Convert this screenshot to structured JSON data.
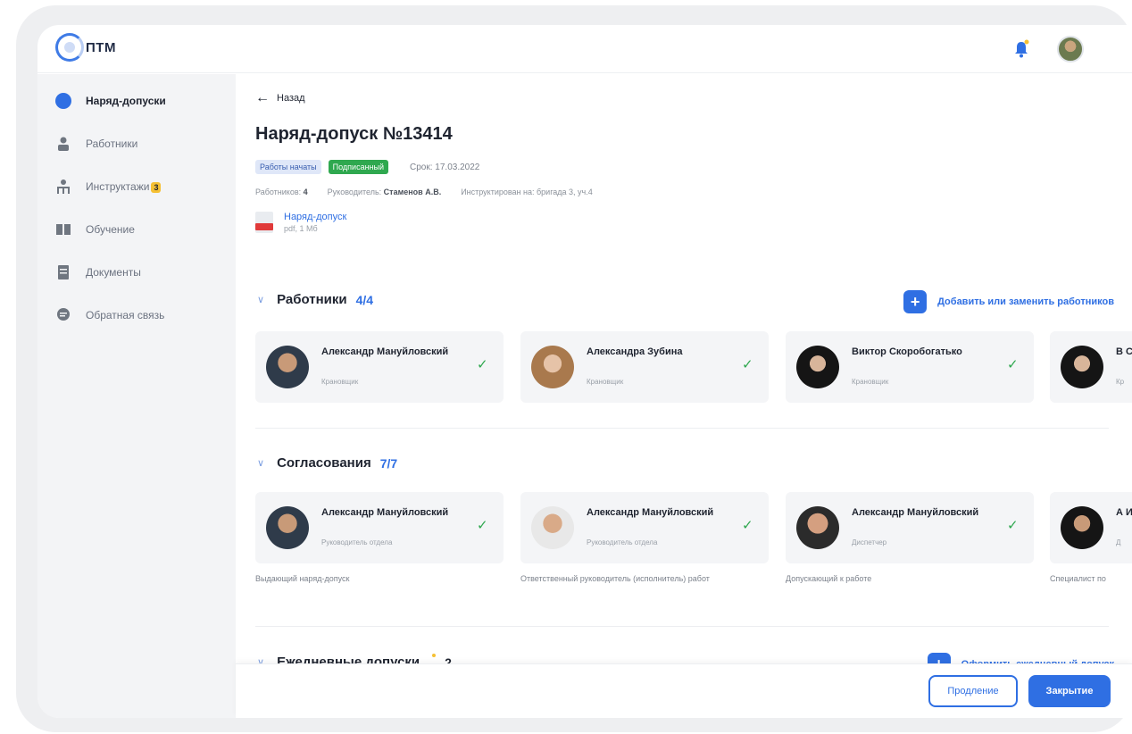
{
  "app": {
    "logo_text": "ПТМ"
  },
  "sidebar": {
    "items": [
      {
        "label": "Наряд-допуски",
        "icon": "circle-icon",
        "active": true
      },
      {
        "label": "Работники",
        "icon": "worker-icon"
      },
      {
        "label": "Инструктажи",
        "icon": "people-icon",
        "badge": "3"
      },
      {
        "label": "Обучение",
        "icon": "book-icon"
      },
      {
        "label": "Документы",
        "icon": "document-icon"
      },
      {
        "label": "Обратная связь",
        "icon": "chat-icon"
      }
    ]
  },
  "header": {
    "back_label": "Назад",
    "title": "Наряд-допуск №13414",
    "tag_status1": "Работы начаты",
    "tag_status2": "Подписанный",
    "deadline": "Срок: 17.03.2022",
    "meta": {
      "workers_label": "Работников:",
      "workers_value": "4",
      "manager_label": "Руководитель:",
      "manager_value": "Стаменов А.В.",
      "instruction_label": "Инструктирован на: бригада 3, уч.4",
      "instruction_value": ""
    },
    "document": {
      "name": "Наряд-допуск",
      "size": "pdf, 1 Мб"
    }
  },
  "sections": {
    "workers": {
      "title": "Работники",
      "count": "4/4",
      "action": "Добавить или заменить работников",
      "cards": [
        {
          "name": "Александр Мануйловский",
          "role": "Крановщик"
        },
        {
          "name": "Александра Зубина",
          "role": "Крановщик"
        },
        {
          "name": "Виктор Скоробогатько",
          "role": "Крановщик"
        },
        {
          "name": "В С",
          "role": "Кр"
        }
      ]
    },
    "approvals": {
      "title": "Согласования",
      "count": "7/7",
      "cards": [
        {
          "name": "Александр Мануйловский",
          "role": "Руководитель отдела",
          "caption": "Выдающий наряд-допуск"
        },
        {
          "name": "Александр Мануйловский",
          "role": "Руководитель отдела",
          "caption": "Ответственный руководитель (исполнитель) работ"
        },
        {
          "name": "Александр Мануйловский",
          "role": "Диспетчер",
          "caption": "Допускающий к работе"
        },
        {
          "name": "А И",
          "role": "Д",
          "caption": "Специалист по"
        }
      ]
    },
    "daily": {
      "title": "Ежедневные допуски",
      "count": "2",
      "action": "Оформить ежедневный допуск"
    }
  },
  "footer": {
    "extend_label": "Продление",
    "close_label": "Закрытие"
  },
  "colors": {
    "accent": "#2f6fe3",
    "success": "#2fa84f",
    "badge": "#f5c033",
    "danger": "#e03a3a"
  }
}
